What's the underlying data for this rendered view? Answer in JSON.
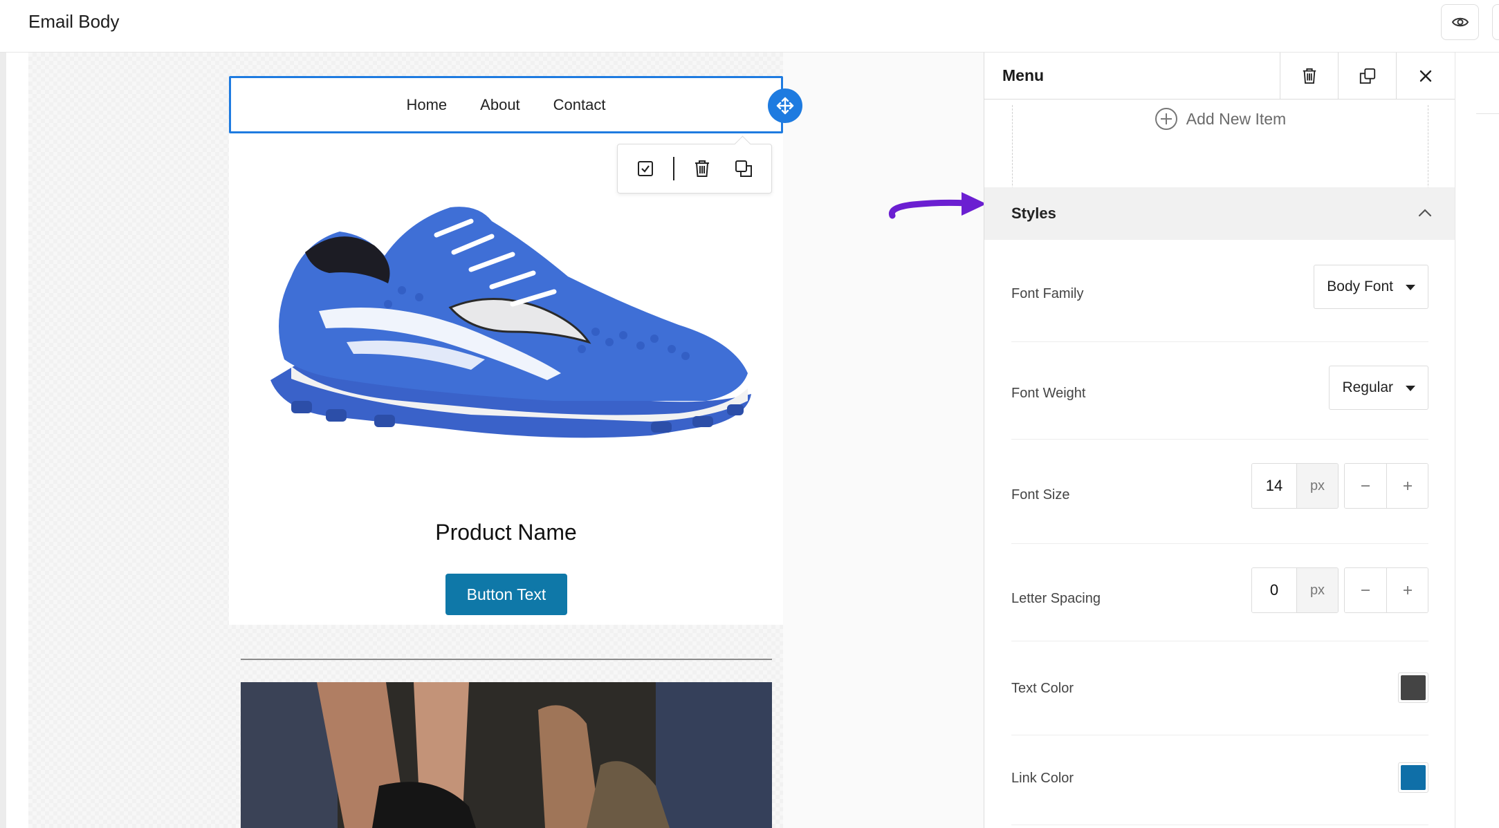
{
  "topbar": {
    "title": "Email Body",
    "preview_icon": "eye-icon"
  },
  "email": {
    "menu": {
      "items": [
        "Home",
        "About",
        "Contact"
      ]
    },
    "block_toolbar": {
      "icons": [
        "checkbox-icon",
        "trash-icon",
        "duplicate-icon"
      ]
    },
    "product_name": "Product Name",
    "button_text": "Button Text"
  },
  "panel": {
    "title": "Menu",
    "header_icons": [
      "trash-icon",
      "duplicate-icon",
      "close-icon"
    ],
    "add_item_label": "Add New Item",
    "styles": {
      "title": "Styles",
      "font_family": {
        "label": "Font Family",
        "value": "Body Font"
      },
      "font_weight": {
        "label": "Font Weight",
        "value": "Regular"
      },
      "font_size": {
        "label": "Font Size",
        "value": "14",
        "unit": "px"
      },
      "letter_spacing": {
        "label": "Letter Spacing",
        "value": "0",
        "unit": "px"
      },
      "text_color": {
        "label": "Text Color",
        "value": "#444444"
      },
      "link_color": {
        "label": "Link Color",
        "value": "#0f6fa8"
      }
    }
  },
  "colors": {
    "accent": "#1e7be0",
    "button": "#0f78a8",
    "annotation_arrow": "#6b1fd1"
  }
}
